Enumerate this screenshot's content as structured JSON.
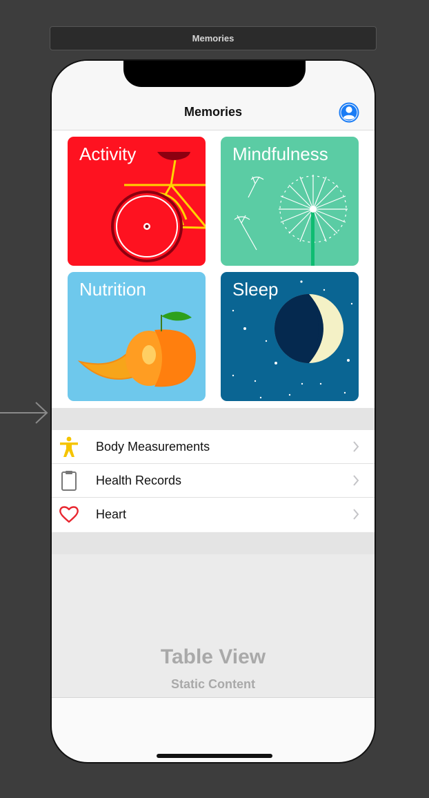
{
  "scene": {
    "title": "Memories"
  },
  "nav": {
    "title": "Memories",
    "profile_icon": "person-circle-icon",
    "accent": "#1a7cf5"
  },
  "tiles": [
    {
      "label": "Activity",
      "color": "#fe1220",
      "illustration": "bicycle-icon"
    },
    {
      "label": "Mindfulness",
      "color": "#5bcca4",
      "illustration": "dandelion-icon"
    },
    {
      "label": "Nutrition",
      "color": "#6ec8ec",
      "illustration": "peach-icon"
    },
    {
      "label": "Sleep",
      "color": "#0a6593",
      "illustration": "moon-icon"
    }
  ],
  "rows": [
    {
      "label": "Body Measurements",
      "icon": "body-figure-icon",
      "icon_color": "#f5c400"
    },
    {
      "label": "Health Records",
      "icon": "clipboard-icon",
      "icon_color": "#777777"
    },
    {
      "label": "Heart",
      "icon": "heart-icon",
      "icon_color": "#e8262f"
    }
  ],
  "placeholder": {
    "title": "Table View",
    "subtitle": "Static Content"
  }
}
